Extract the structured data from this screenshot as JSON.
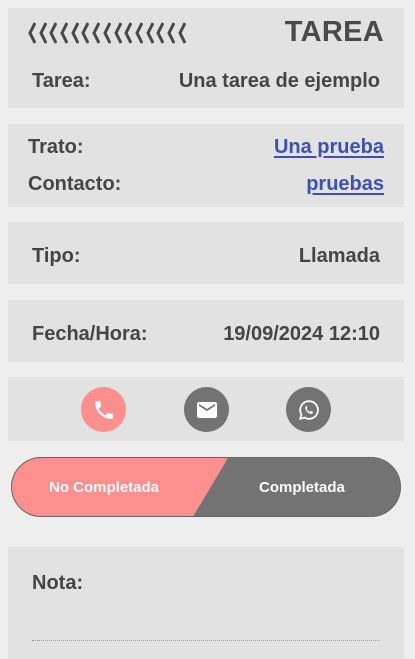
{
  "header": {
    "title": "TAREA",
    "chevron_count": 15
  },
  "tarea": {
    "label": "Tarea:",
    "value": "Una tarea de ejemplo"
  },
  "trato": {
    "label": "Trato:",
    "value": "Una prueba"
  },
  "contacto": {
    "label": "Contacto:",
    "value": "pruebas"
  },
  "tipo": {
    "label": "Tipo:",
    "value": "Llamada"
  },
  "fecha": {
    "label": "Fecha/Hora:",
    "value": "19/09/2024 12:10"
  },
  "actions": {
    "items": [
      {
        "icon": "phone-icon",
        "color": "#fe8f8f",
        "active": true
      },
      {
        "icon": "email-icon",
        "color": "#737373",
        "active": false
      },
      {
        "icon": "whatsapp-icon",
        "color": "#737373",
        "active": false
      }
    ]
  },
  "status": {
    "left_label": "No Completada",
    "right_label": "Completada",
    "selected": "No Completada",
    "colors": {
      "selected": "#fe8f8f",
      "unselected": "#737373"
    }
  },
  "nota": {
    "label": "Nota:",
    "value": ""
  }
}
